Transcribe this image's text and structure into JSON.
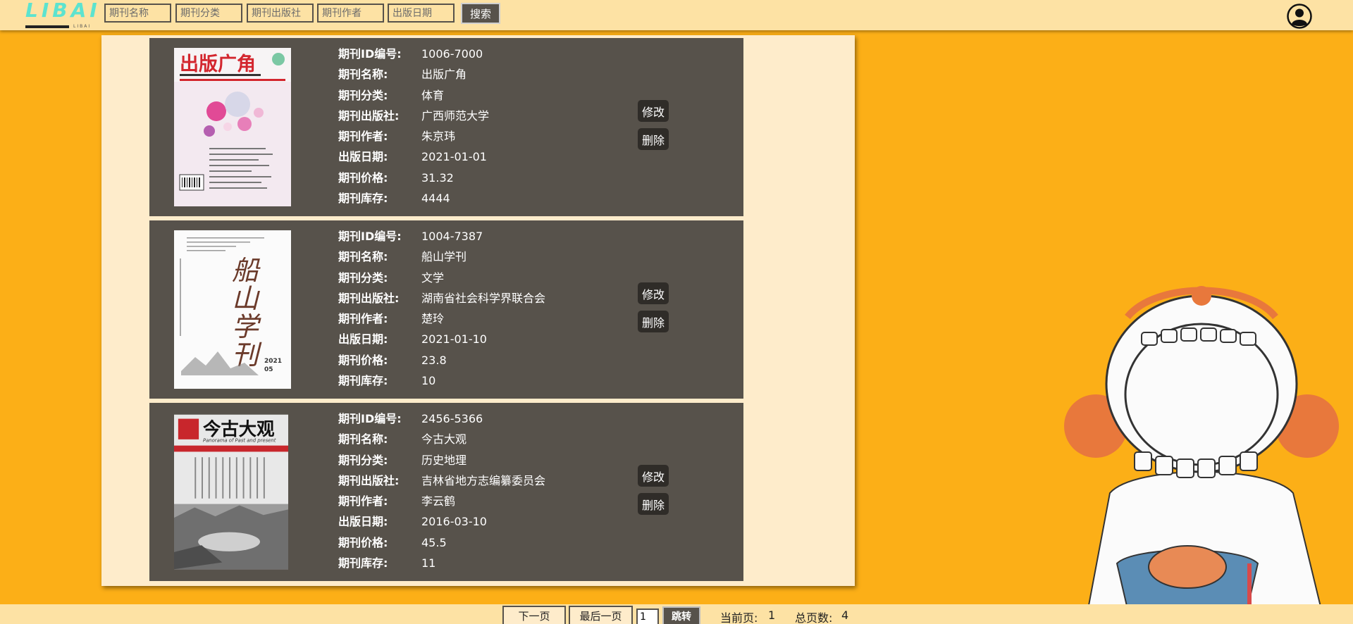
{
  "app": {
    "logo_text": "LIBAI",
    "logo_sub": "LIBAI"
  },
  "search": {
    "name_placeholder": "期刊名称",
    "category_placeholder": "期刊分类",
    "publisher_placeholder": "期刊出版社",
    "author_placeholder": "期刊作者",
    "date_placeholder": "出版日期",
    "button_label": "搜索"
  },
  "labels": {
    "id": "期刊ID编号:",
    "name": "期刊名称:",
    "category": "期刊分类:",
    "publisher": "期刊出版社:",
    "author": "期刊作者:",
    "date": "出版日期:",
    "price": "期刊价格:",
    "stock": "期刊库存:",
    "edit": "修改",
    "delete": "删除"
  },
  "journals": [
    {
      "cover_title": "出版广角",
      "id": "1006-7000",
      "name": "出版广角",
      "category": "体育",
      "publisher": "广西师范大学",
      "author": "朱京玮",
      "date": "2021-01-01",
      "price": "31.32",
      "stock": "4444"
    },
    {
      "cover_title": "船山学刊",
      "id": "1004-7387",
      "name": "船山学刊",
      "category": "文学",
      "publisher": "湖南省社会科学界联合会",
      "author": "楚玲",
      "date": "2021-01-10",
      "price": "23.8",
      "stock": "10"
    },
    {
      "cover_title": "今古大观",
      "id": "2456-5366",
      "name": "今古大观",
      "category": "历史地理",
      "publisher": "吉林省地方志编纂委员会",
      "author": "李云鹤",
      "date": "2016-03-10",
      "price": "45.5",
      "stock": "11"
    }
  ],
  "pagination": {
    "next_label": "下一页",
    "last_label": "最后一页",
    "page_input_value": "1",
    "jump_label": "跳转",
    "current_page_label": "当前页:",
    "current_page": "1",
    "total_pages_label": "总页数:",
    "total_pages": "4"
  },
  "colors": {
    "background": "#fcaf17",
    "topbar": "#fde2a4",
    "panel": "#feeccb",
    "card": "#57524b",
    "button": "#2f2c28",
    "logo": "#5de3cf"
  }
}
